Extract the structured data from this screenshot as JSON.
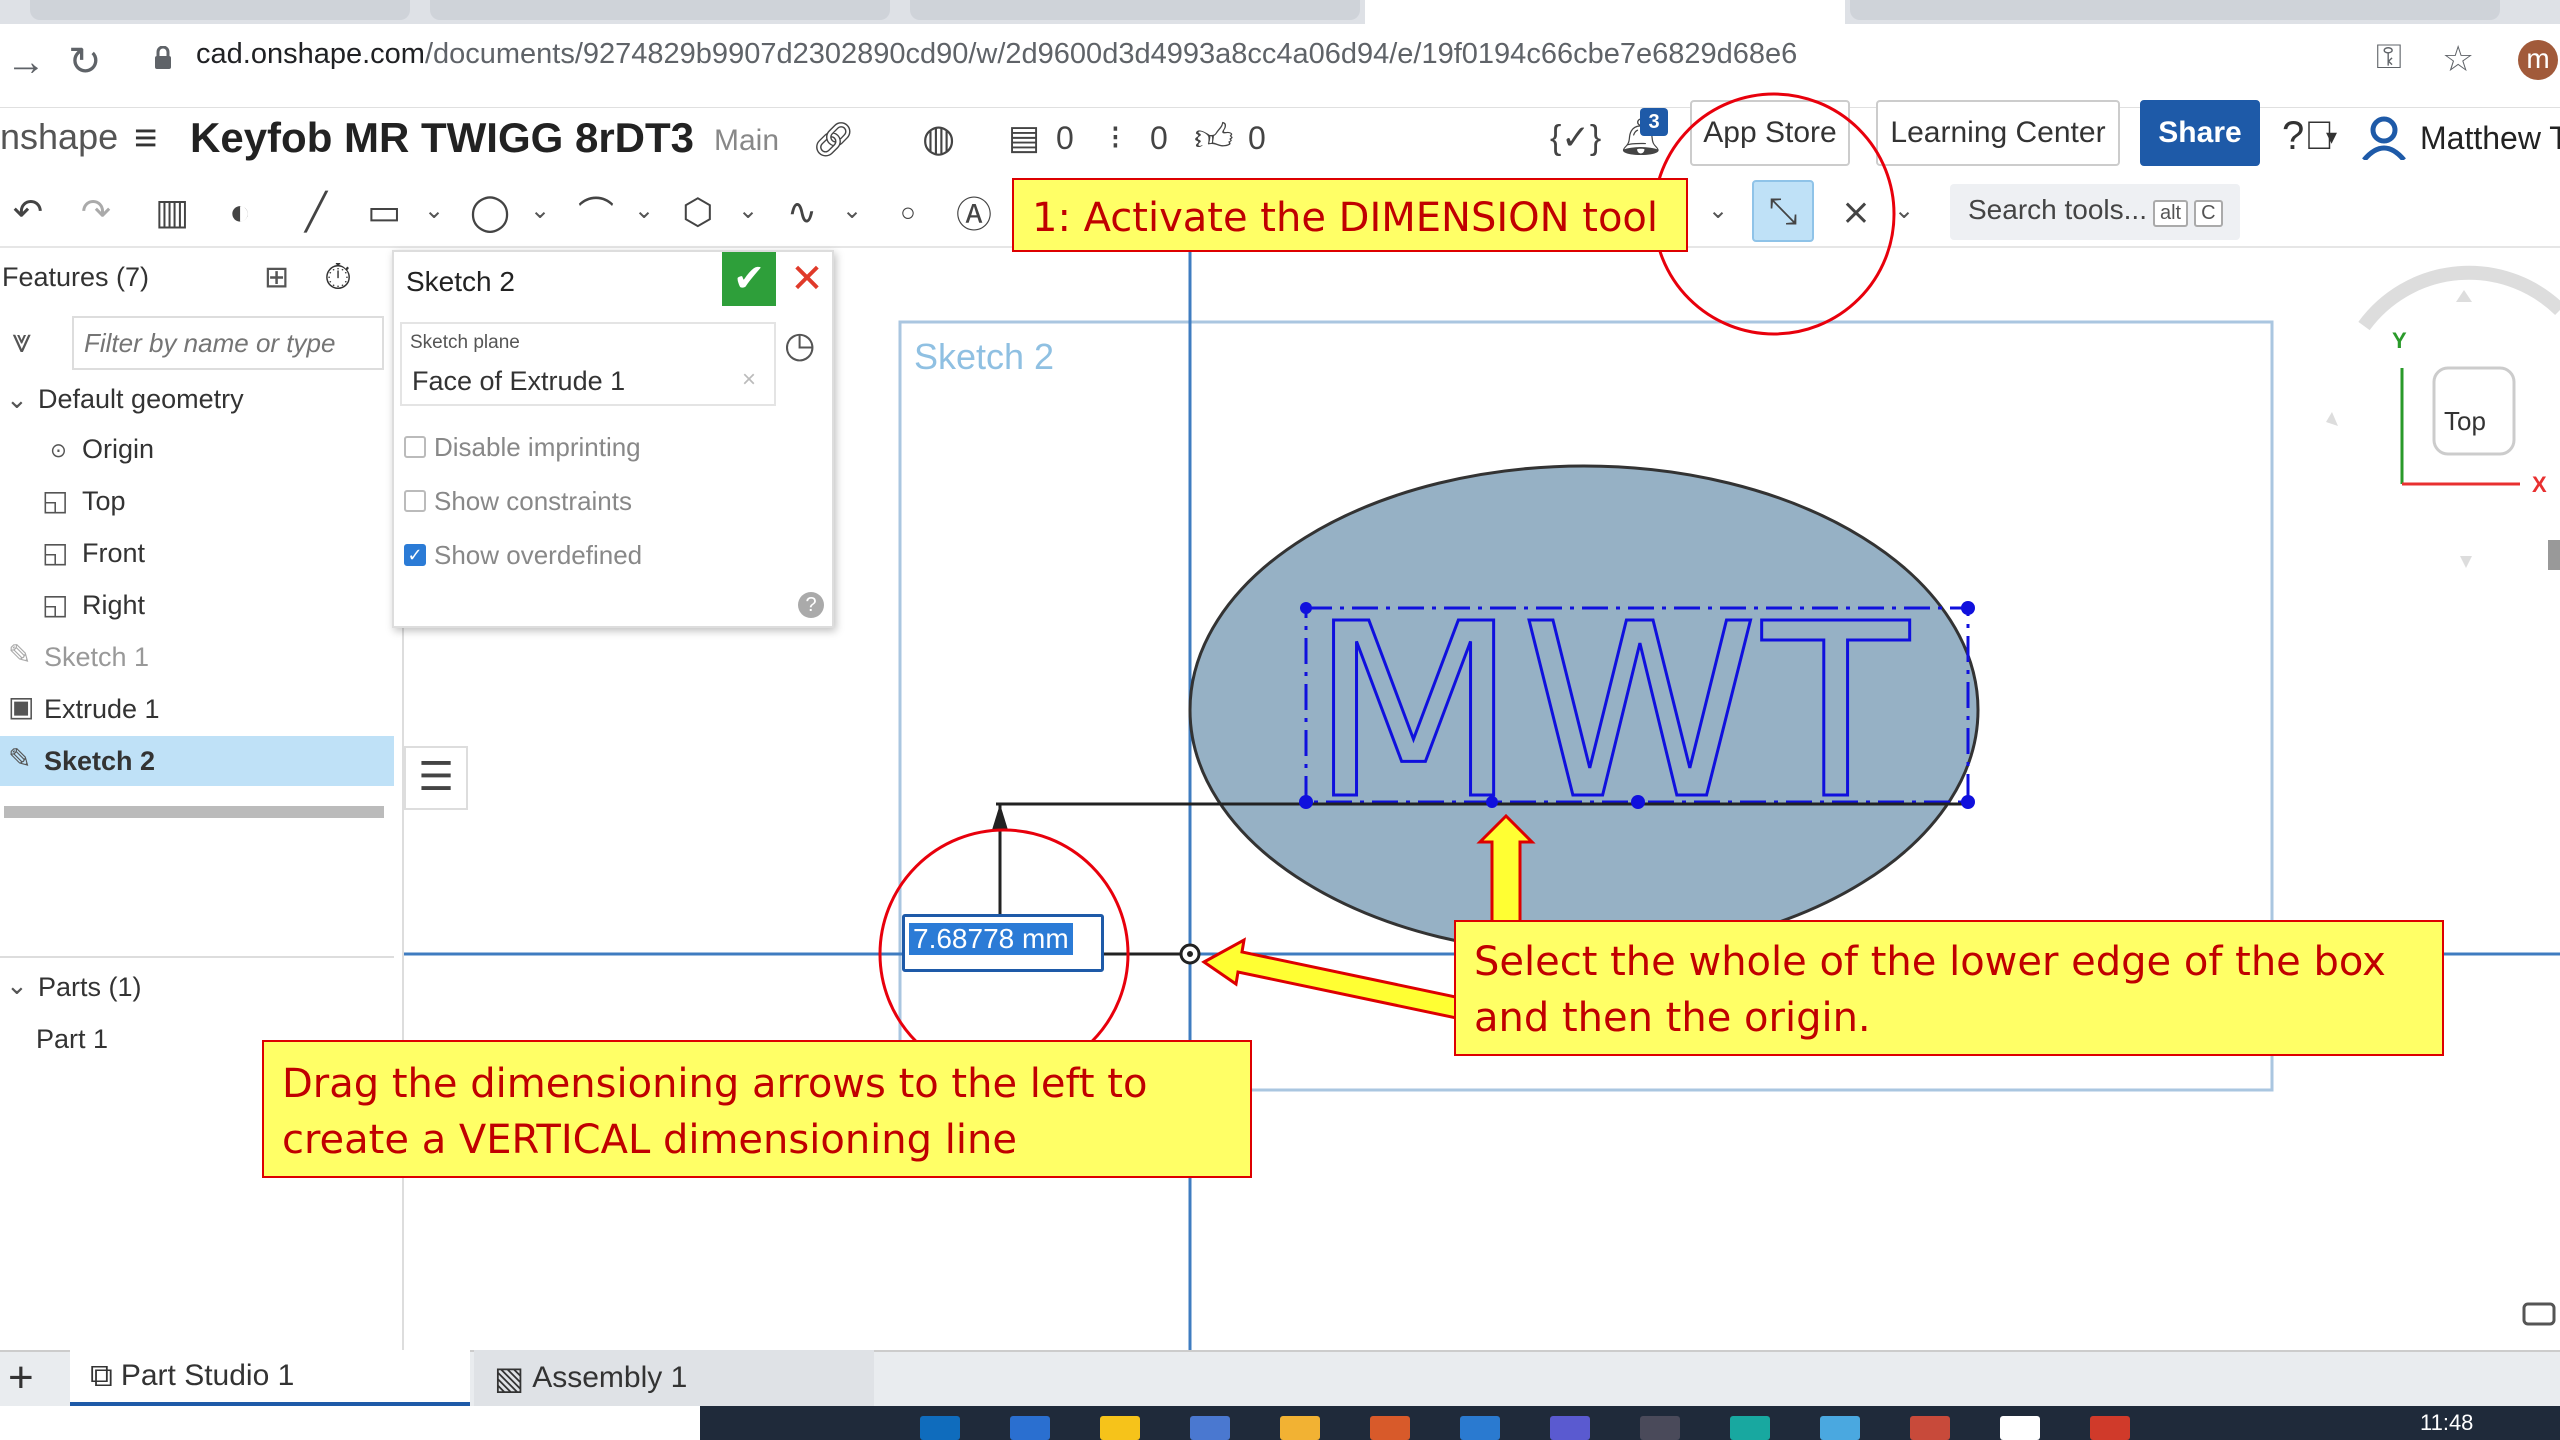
{
  "browser": {
    "url_host": "cad.onshape.com",
    "url_path": "/documents/9274829b9907d2302890cd90/w/2d9600d3d4993a8cc4a06d94/e/19f0194c66cbe7e6829d68e6",
    "profile_initial": "m"
  },
  "header": {
    "logo_text": "nshape",
    "doc_title": "Keyfob MR TWIGG 8rDT3",
    "branch": "Main",
    "versions_count": "0",
    "branches_count": "0",
    "likes_count": "0",
    "notification_badge": "3",
    "app_store": "App Store",
    "learning_center": "Learning Center",
    "share": "Share",
    "user_name": "Matthew Tv"
  },
  "toolbar": {
    "search_placeholder": "Search tools...",
    "search_kbd_1": "alt",
    "search_kbd_2": "C"
  },
  "features": {
    "header": "Features (7)",
    "filter_placeholder": "Filter by name or type",
    "default_geometry": "Default geometry",
    "items": [
      "Origin",
      "Top",
      "Front",
      "Right"
    ],
    "sketch1": "Sketch 1",
    "extrude1": "Extrude 1",
    "sketch2": "Sketch 2",
    "parts_header": "Parts (1)",
    "part1": "Part 1"
  },
  "sketch_dialog": {
    "title": "Sketch 2",
    "plane_label": "Sketch plane",
    "plane_value": "Face of Extrude 1",
    "disable_imprinting": "Disable imprinting",
    "show_constraints": "Show constraints",
    "show_overdefined": "Show overdefined"
  },
  "viewport": {
    "sketch_label": "Sketch 2",
    "sketch_text": "MWT",
    "dimension_value": "7.68778 mm",
    "view_cube_label": "Top",
    "axis_x": "X",
    "axis_y": "Y"
  },
  "annotations": {
    "step1": "1: Activate the DIMENSION tool",
    "select_line1": "Select the whole of the lower edge of the box",
    "select_line2": "and then the origin.",
    "drag_line1": "Drag the dimensioning arrows to the left to",
    "drag_line2": "create a VERTICAL  dimensioning line"
  },
  "bottom_tabs": {
    "add": "+",
    "part_studio": "Part Studio 1",
    "assembly": "Assembly 1"
  },
  "taskbar": {
    "clock": "11:48"
  },
  "colors": {
    "sketch_fill": "#96b1c5",
    "sketch_text_stroke": "#1010dd",
    "callout_bg": "#ffff66",
    "callout_text": "#c00000",
    "share_bg": "#1e5aa8",
    "selection_bg": "#bfe1f7"
  }
}
